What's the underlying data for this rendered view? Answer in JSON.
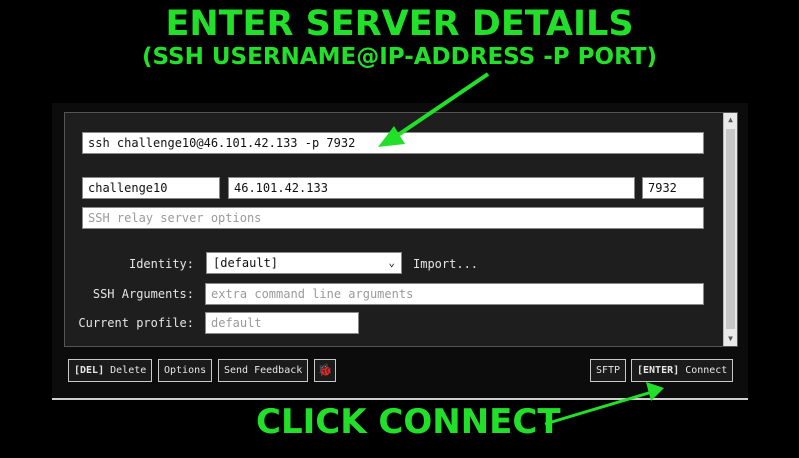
{
  "annotations": {
    "heading": "ENTER SERVER DETAILS",
    "subheading": "(SSH USERNAME@IP-ADDRESS -P PORT)",
    "footer": "CLICK CONNECT",
    "accent_color": "#22e02a"
  },
  "connection": {
    "command": "ssh challenge10@46.101.42.133 -p 7932",
    "username": "challenge10",
    "host": "46.101.42.133",
    "port": "7932",
    "relay_placeholder": "SSH relay server options"
  },
  "identity": {
    "label": "Identity:",
    "selected": "[default]",
    "import_label": "Import..."
  },
  "ssh_arguments": {
    "label": "SSH Arguments:",
    "placeholder": "extra command line arguments"
  },
  "profile": {
    "label": "Current profile:",
    "placeholder": "default"
  },
  "buttons": {
    "delete_key": "[DEL]",
    "delete": "Delete",
    "options": "Options",
    "feedback": "Send Feedback",
    "bug_icon": "bug-icon",
    "sftp": "SFTP",
    "connect_key": "[ENTER]",
    "connect": "Connect"
  }
}
